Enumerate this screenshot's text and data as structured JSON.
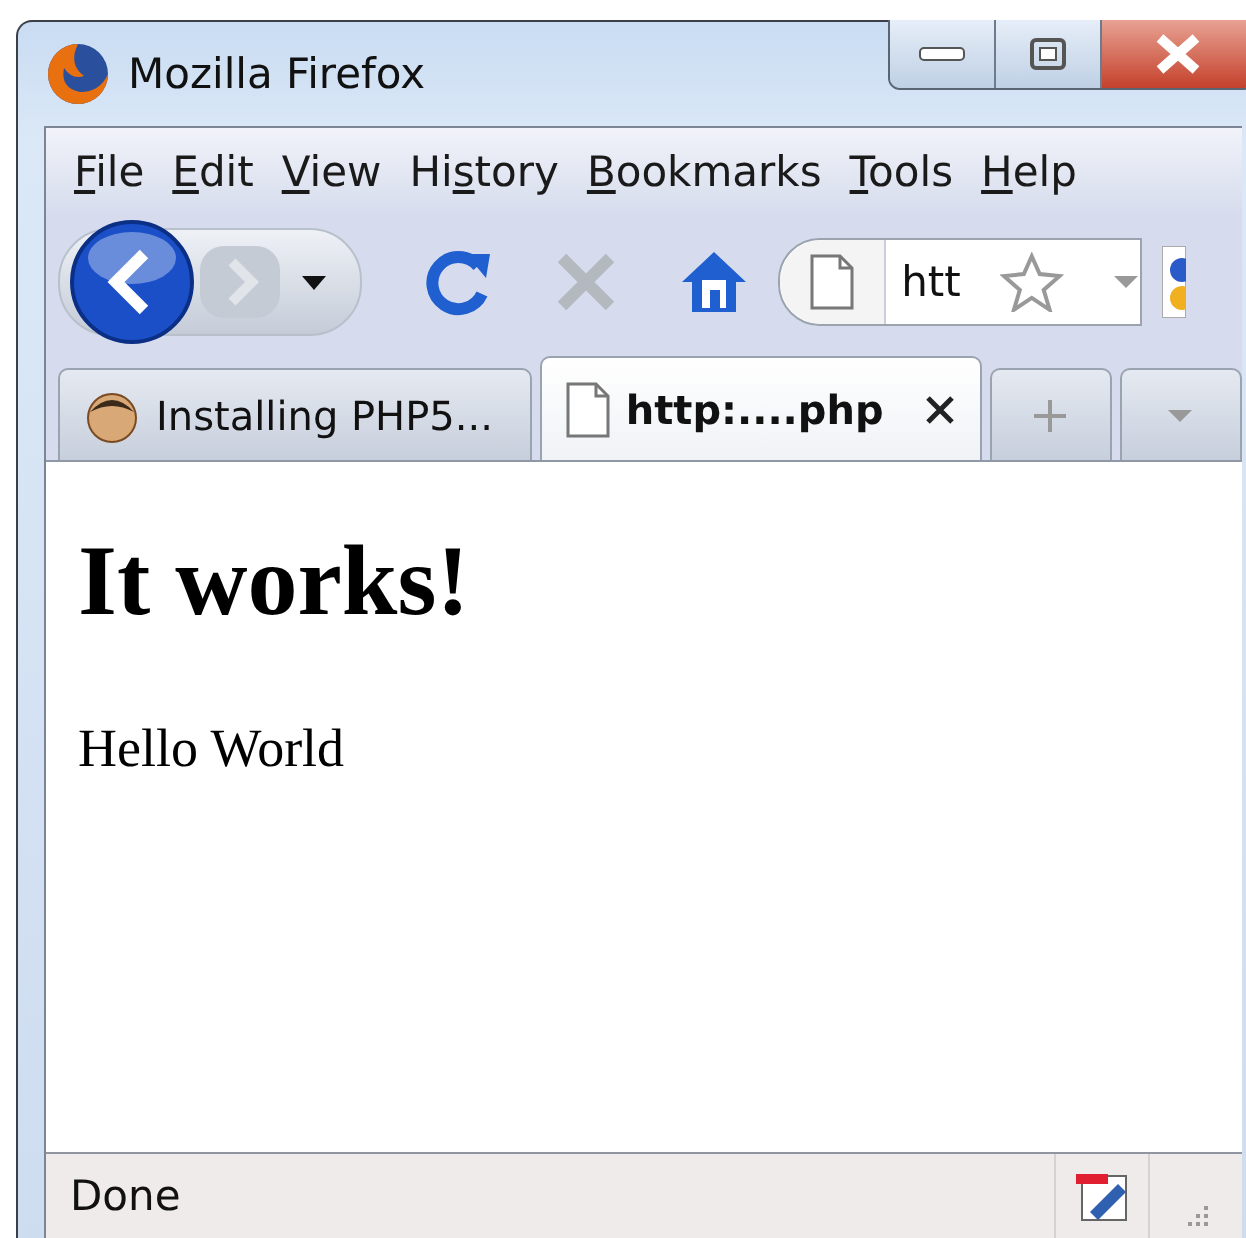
{
  "window": {
    "title": "Mozilla Firefox"
  },
  "menu": [
    {
      "key": "F",
      "suffix": "ile"
    },
    {
      "key": "E",
      "suffix": "dit"
    },
    {
      "key": "V",
      "suffix": "iew"
    },
    {
      "prefix": "Hi",
      "key": "s",
      "suffix": "tory"
    },
    {
      "key": "B",
      "suffix": "ookmarks"
    },
    {
      "key": "T",
      "suffix": "ools"
    },
    {
      "key": "H",
      "suffix": "elp"
    }
  ],
  "toolbar": {
    "buttons": [
      {
        "kind": "back",
        "disabled": false
      },
      {
        "kind": "forward",
        "disabled": true
      },
      {
        "kind": "reload",
        "disabled": false
      },
      {
        "kind": "stop",
        "disabled": true
      },
      {
        "kind": "home",
        "disabled": false
      }
    ],
    "address": {
      "value": "htt"
    }
  },
  "tabs": [
    {
      "label": "Installing PHP5...",
      "kind": "avatar",
      "selected": false
    },
    {
      "label": "http:....php",
      "kind": "page",
      "selected": true
    }
  ],
  "page": {
    "heading": "It works!",
    "text": "Hello World"
  },
  "status_bar": {
    "text": "Done"
  }
}
